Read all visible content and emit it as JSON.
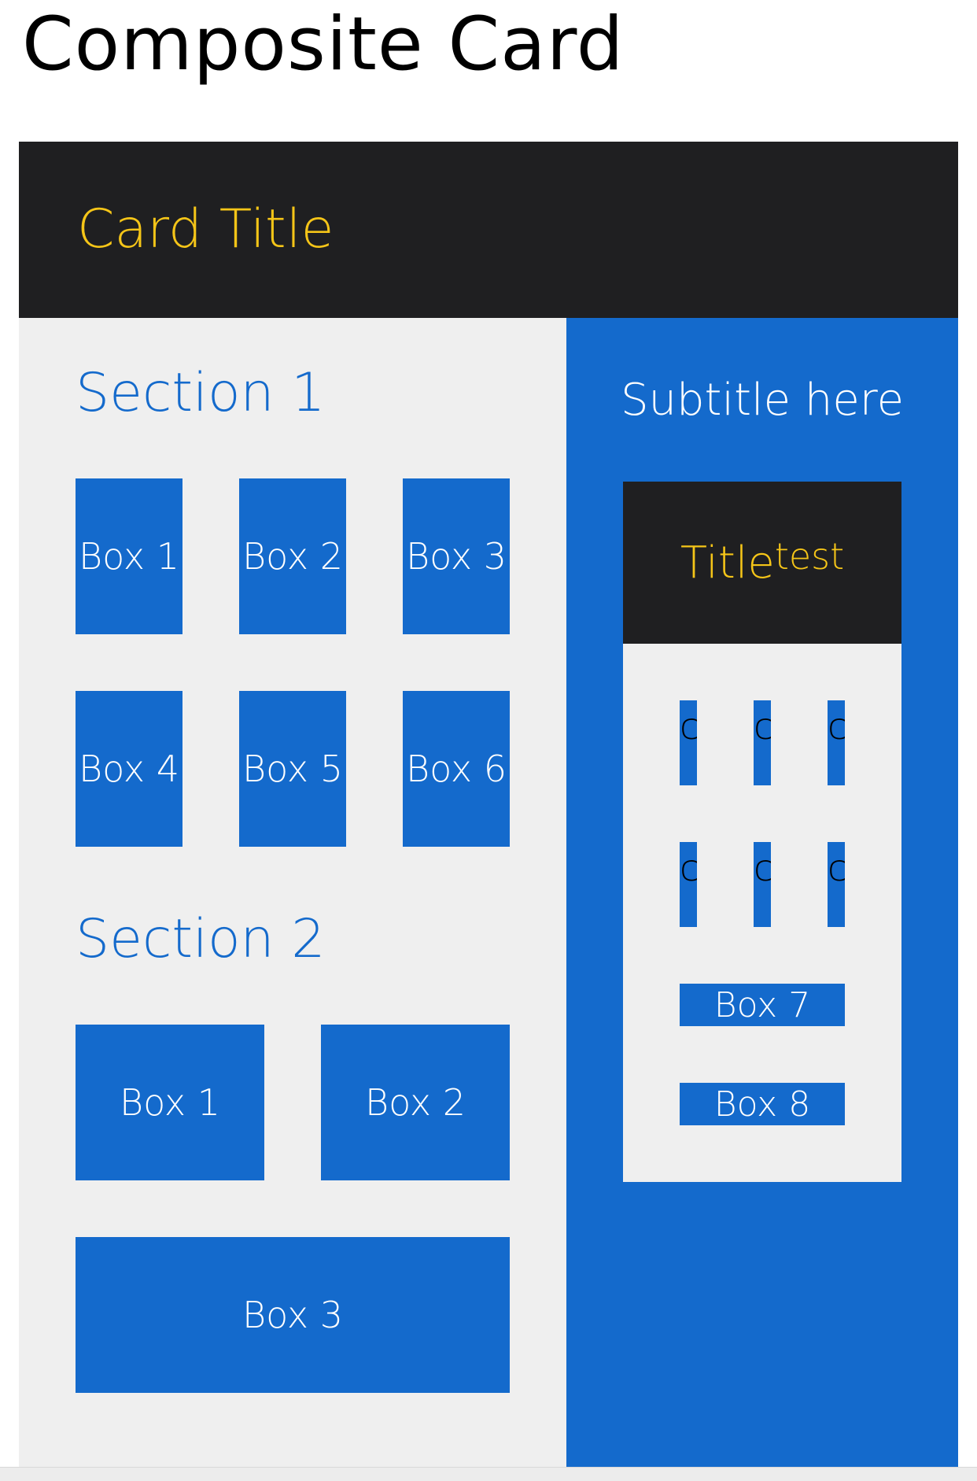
{
  "page": {
    "title": "Composite Card"
  },
  "card": {
    "title": "Card Title",
    "left": {
      "section1": {
        "title": "Section 1",
        "boxes": [
          "Box 1",
          "Box 2",
          "Box 3",
          "Box 4",
          "Box 5",
          "Box 6"
        ]
      },
      "section2": {
        "title": "Section 2",
        "boxes": [
          "Box 1",
          "Box 2",
          "Box 3"
        ]
      }
    },
    "right": {
      "subtitle": "Subtitle here",
      "inner_card": {
        "title": "Title",
        "title_suffix": "test",
        "mini_boxes": [
          "c",
          "c",
          "c",
          "c",
          "c",
          "c"
        ],
        "wide_boxes": [
          "Box 7",
          "Box 8"
        ]
      }
    }
  },
  "colors": {
    "accent_blue": "#146acc",
    "header_dark": "#1f1f21",
    "title_yellow": "#f5c518",
    "panel_gray": "#efefef"
  }
}
